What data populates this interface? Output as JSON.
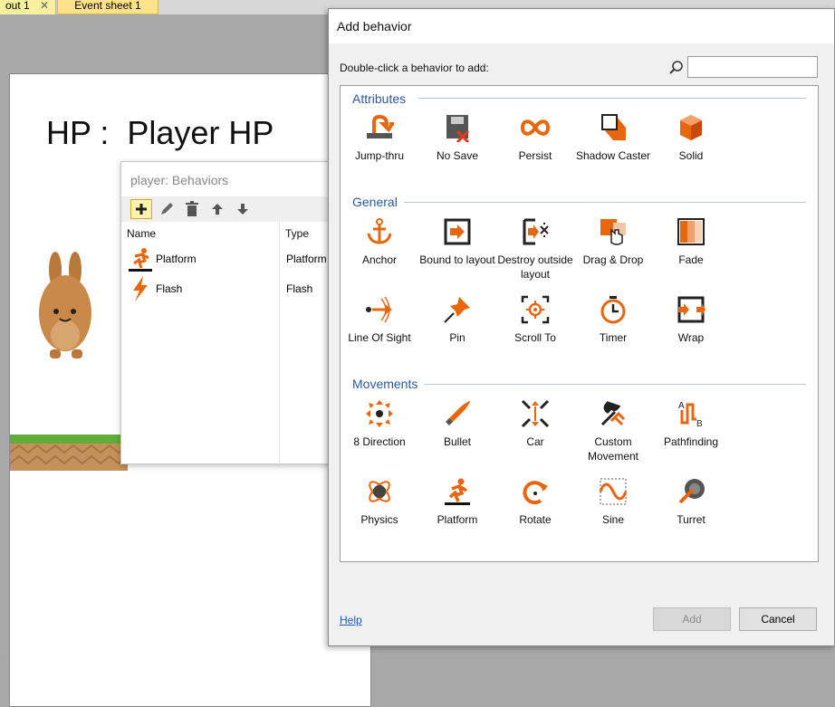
{
  "tabs": [
    {
      "label": "out 1",
      "close": "✕"
    },
    {
      "label": "Event sheet 1"
    }
  ],
  "layout": {
    "hp_text": "HP :  Player HP"
  },
  "behaviors_panel": {
    "title": "player: Behaviors",
    "columns": [
      "Name",
      "Type"
    ],
    "rows": [
      {
        "name": "Platform",
        "type": "Platform",
        "icon": "platform-icon"
      },
      {
        "name": "Flash",
        "type": "Flash",
        "icon": "flash-icon"
      }
    ]
  },
  "dialog": {
    "title": "Add behavior",
    "hint": "Double-click a behavior to add:",
    "search_value": "",
    "categories": [
      {
        "name": "Attributes",
        "items": [
          {
            "label": "Jump-thru",
            "icon": "jump-thru-icon"
          },
          {
            "label": "No Save",
            "icon": "no-save-icon"
          },
          {
            "label": "Persist",
            "icon": "persist-icon"
          },
          {
            "label": "Shadow Caster",
            "icon": "shadow-caster-icon"
          },
          {
            "label": "Solid",
            "icon": "solid-icon"
          }
        ]
      },
      {
        "name": "General",
        "items": [
          {
            "label": "Anchor",
            "icon": "anchor-icon"
          },
          {
            "label": "Bound to layout",
            "icon": "bound-to-layout-icon"
          },
          {
            "label": "Destroy outside layout",
            "icon": "destroy-outside-layout-icon"
          },
          {
            "label": "Drag & Drop",
            "icon": "drag-drop-icon"
          },
          {
            "label": "Fade",
            "icon": "fade-icon"
          },
          {
            "label": "Line Of Sight",
            "icon": "line-of-sight-icon"
          },
          {
            "label": "Pin",
            "icon": "pin-icon"
          },
          {
            "label": "Scroll To",
            "icon": "scroll-to-icon"
          },
          {
            "label": "Timer",
            "icon": "timer-icon"
          },
          {
            "label": "Wrap",
            "icon": "wrap-icon"
          }
        ]
      },
      {
        "name": "Movements",
        "items": [
          {
            "label": "8 Direction",
            "icon": "8-direction-icon"
          },
          {
            "label": "Bullet",
            "icon": "bullet-icon"
          },
          {
            "label": "Car",
            "icon": "car-icon"
          },
          {
            "label": "Custom Movement",
            "icon": "custom-movement-icon"
          },
          {
            "label": "Pathfinding",
            "icon": "pathfinding-icon"
          },
          {
            "label": "Physics",
            "icon": "physics-icon"
          },
          {
            "label": "Platform",
            "icon": "platform-icon"
          },
          {
            "label": "Rotate",
            "icon": "rotate-icon"
          },
          {
            "label": "Sine",
            "icon": "sine-icon"
          },
          {
            "label": "Turret",
            "icon": "turret-icon"
          }
        ]
      }
    ],
    "help_label": "Help",
    "add_label": "Add",
    "cancel_label": "Cancel"
  },
  "colors": {
    "accent": "#e8660d",
    "category": "#2a5a9a"
  }
}
